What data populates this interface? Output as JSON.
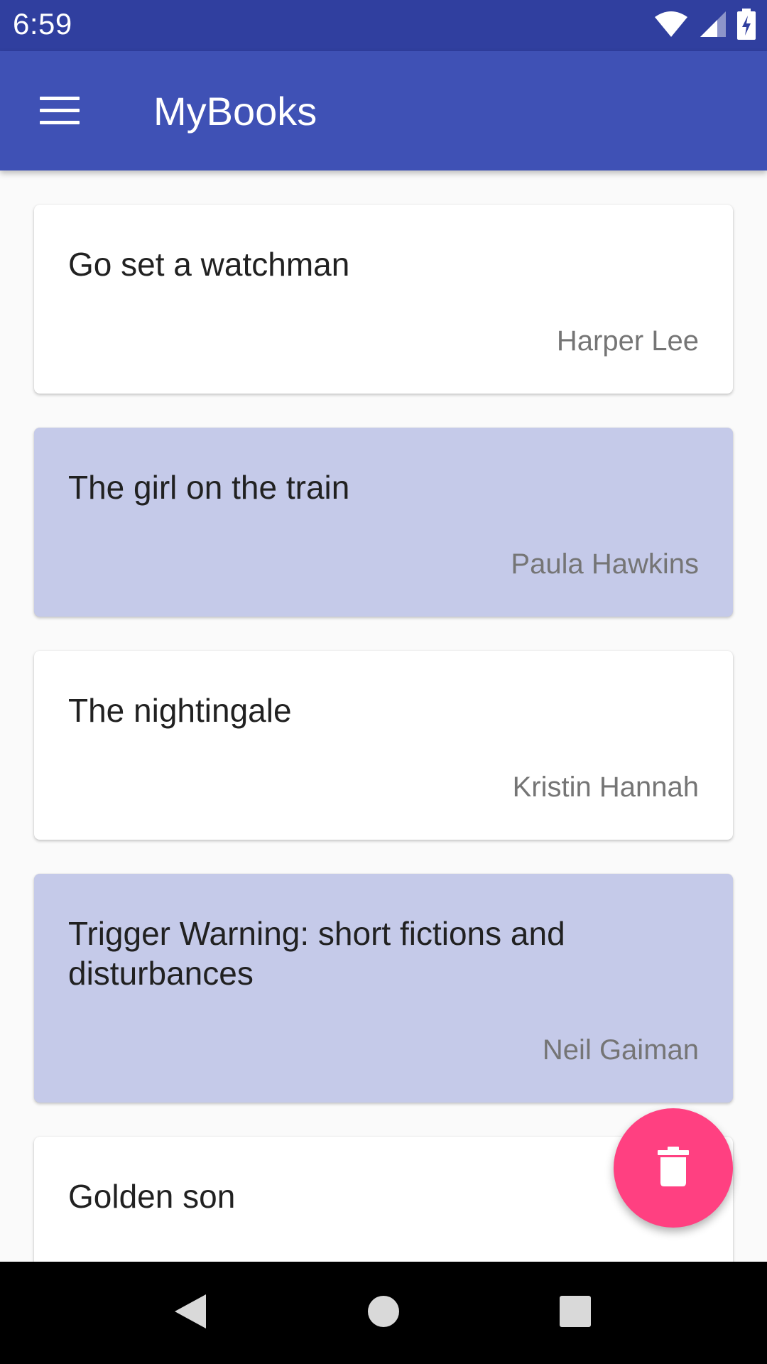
{
  "status_bar": {
    "time": "6:59",
    "icons": [
      "wifi-icon",
      "cellular-signal-icon",
      "battery-charging-icon"
    ]
  },
  "app_bar": {
    "title": "MyBooks",
    "menu_icon": "hamburger-menu-icon"
  },
  "books": [
    {
      "title": "Go set a watchman",
      "author": "Harper Lee",
      "selected": false
    },
    {
      "title": "The girl on the train",
      "author": "Paula Hawkins",
      "selected": true
    },
    {
      "title": "The nightingale",
      "author": "Kristin Hannah",
      "selected": false
    },
    {
      "title": "Trigger Warning: short fictions and disturbances",
      "author": "Neil Gaiman",
      "selected": true
    },
    {
      "title": "Golden son",
      "author": "",
      "selected": false
    }
  ],
  "fab": {
    "icon": "delete-icon",
    "color": "#ff4081"
  },
  "nav_bar": {
    "icons": [
      "back-icon",
      "home-icon",
      "recents-icon"
    ]
  },
  "colors": {
    "primary": "#3f51b5",
    "primary_dark": "#303f9f",
    "accent": "#ff4081",
    "selected_card": "#c5cae9"
  }
}
